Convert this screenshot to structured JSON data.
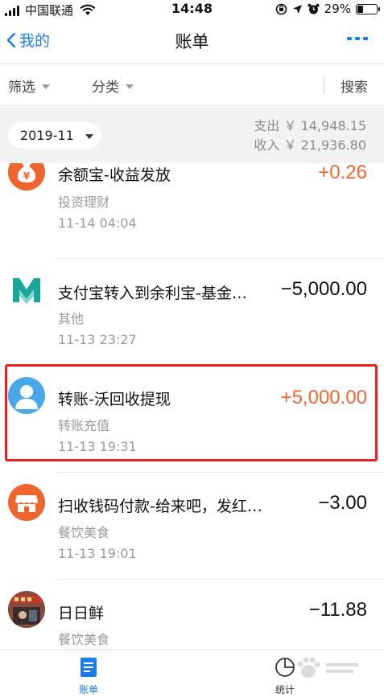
{
  "status_bar": {
    "carrier": "中国联通",
    "time": "14:48",
    "battery": "29%",
    "battery_level": 0.29
  },
  "nav": {
    "back_label": "我的",
    "title": "账单"
  },
  "filter_bar": {
    "filter_label": "筛选",
    "category_label": "分类",
    "search_label": "搜索"
  },
  "summary": {
    "month": "2019-11",
    "expense": "支出 ￥ 14,948.15",
    "income": "收入 ￥ 21,936.80"
  },
  "transactions": [
    {
      "title": "余额宝-收益发放",
      "category": "投资理财",
      "time": "11-14  04:04",
      "amount": "+0.26",
      "icon": "yuebao-money-bag-icon",
      "color": "#f0642d"
    },
    {
      "title": "支付宝转入到余利宝-基金…",
      "category": "其他",
      "time": "11-13  23:27",
      "amount": "−5,000.00",
      "icon": "yulibao-m-logo-icon",
      "color": "#1aa79a"
    },
    {
      "title": "转账-沃回收提现",
      "category": "转账充值",
      "time": "11-13  19:31",
      "amount": "+5,000.00",
      "icon": "default-user-avatar-icon",
      "color": "#4aa8e8"
    },
    {
      "title": "扫收钱码付款-给来吧，发红包，…",
      "category": "餐饮美食",
      "time": "11-13  19:01",
      "amount": "−3.00",
      "icon": "shop-store-icon",
      "color": "#f0642d"
    },
    {
      "title": "日日鲜",
      "category": "餐饮美食",
      "time": "",
      "amount": "−11.88",
      "icon": "merchant-photo-avatar-icon",
      "color": "#8a4a3a"
    }
  ],
  "tabs": [
    {
      "label": "账单",
      "icon": "bill-document-icon",
      "active": true
    },
    {
      "label": "统计",
      "icon": "pie-chart-icon",
      "active": false
    }
  ],
  "colors": {
    "accent": "#1a7ee8",
    "income": "#f0642d",
    "highlight": "#e8201f"
  }
}
